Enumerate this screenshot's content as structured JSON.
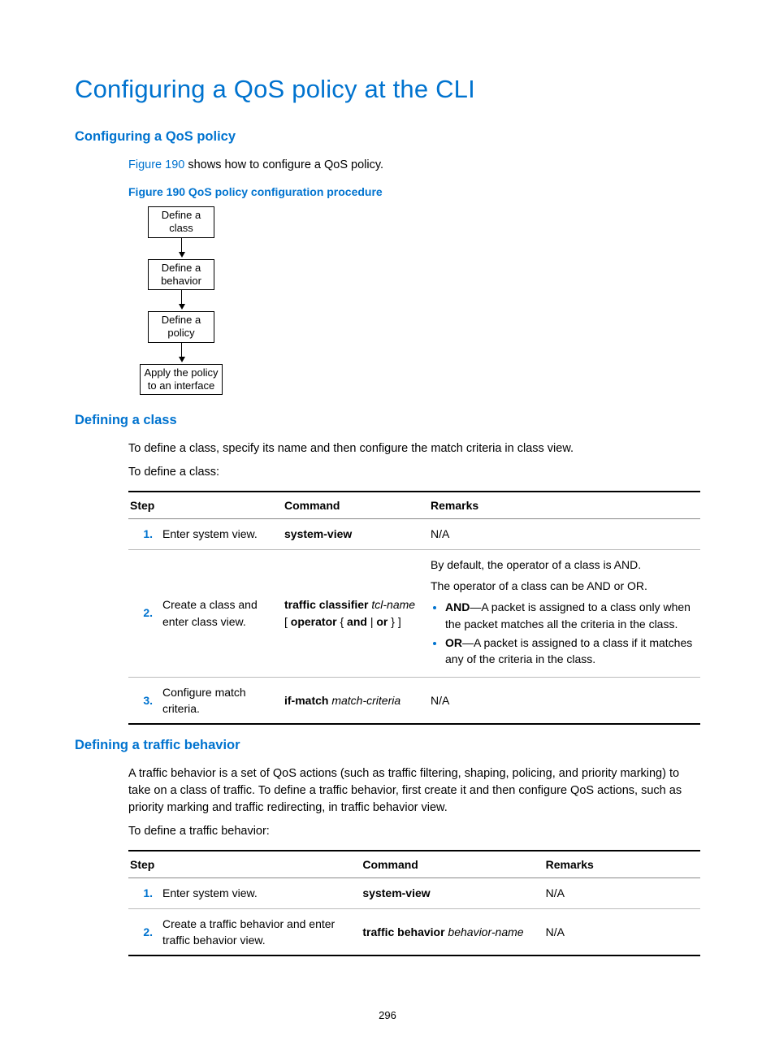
{
  "title": "Configuring a QoS policy at the CLI",
  "section1": {
    "heading": "Configuring a QoS policy",
    "figlink": "Figure 190",
    "figtext_after": " shows how to configure a QoS policy.",
    "figcaption": "Figure 190 QoS policy configuration procedure",
    "flow": {
      "b1": "Define a\nclass",
      "b2": "Define a\nbehavior",
      "b3": "Define a\npolicy",
      "b4": "Apply the policy\nto an interface"
    }
  },
  "section2": {
    "heading": "Defining a class",
    "p1": "To define a class, specify its name and then configure the match criteria in class view.",
    "p2": "To define a class:",
    "table": {
      "h1": "Step",
      "h2": "Command",
      "h3": "Remarks",
      "r1": {
        "n": "1.",
        "step": "Enter system view.",
        "cmd_b": "system-view",
        "rem": "N/A"
      },
      "r2": {
        "n": "2.",
        "step": "Create a class and enter class view.",
        "cmd_b1": "traffic classifier",
        "cmd_i1": " tcl-name",
        "cmd_b2": "operator",
        "cmd_b_and": "and",
        "cmd_b_or": "or",
        "rem_p1": "By default, the operator of a class is AND.",
        "rem_p2": "The operator of a class can be AND or OR.",
        "rem_li1_b": "AND",
        "rem_li1_t": "—A packet is assigned to a class only when the packet matches all the criteria in the class.",
        "rem_li2_b": "OR",
        "rem_li2_t": "—A packet is assigned to a class if it matches any of the criteria in the class."
      },
      "r3": {
        "n": "3.",
        "step": "Configure match criteria.",
        "cmd_b": "if-match",
        "cmd_i": " match-criteria",
        "rem": "N/A"
      }
    }
  },
  "section3": {
    "heading": "Defining a traffic behavior",
    "p1": "A traffic behavior is a set of QoS actions (such as traffic filtering, shaping, policing, and priority marking) to take on a class of traffic. To define a traffic behavior, first create it and then configure QoS actions, such as priority marking and traffic redirecting, in traffic behavior view.",
    "p2": "To define a traffic behavior:",
    "table": {
      "h1": "Step",
      "h2": "Command",
      "h3": "Remarks",
      "r1": {
        "n": "1.",
        "step": "Enter system view.",
        "cmd_b": "system-view",
        "rem": "N/A"
      },
      "r2": {
        "n": "2.",
        "step": "Create a traffic behavior and enter traffic behavior view.",
        "cmd_b": "traffic behavior",
        "cmd_i": " behavior-name",
        "rem": "N/A"
      }
    }
  },
  "pagenum": "296"
}
